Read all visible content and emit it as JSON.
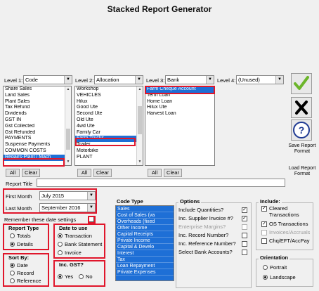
{
  "title": "Stacked Report Generator",
  "levels": [
    {
      "label": "Level 1:",
      "value": "Code"
    },
    {
      "label": "Level 2:",
      "value": "Allocation"
    },
    {
      "label": "Level 3:",
      "value": "Bank"
    },
    {
      "label": "Level 4:",
      "value": "(Unused)"
    }
  ],
  "list1": [
    "Share Sales",
    "Land Sales",
    "Plant Sales",
    "Tax Refund",
    "Dividends",
    "GST IN",
    "Gst Collected",
    "Gst Refunded",
    "PAYMENTS",
    "Suspense Payments",
    "COMMON COSTS",
    "Repairs-Plant / Mach"
  ],
  "list1_selected": "Repairs-Plant / Mach",
  "list2": [
    "Workshop",
    "VEHICLES",
    "Hilux",
    "Good Ute",
    "Second Ute",
    "Old Ute",
    "4wd Ute",
    "Family Car",
    "Farm Trucks",
    "Trailer",
    "Motorbike",
    "PLANT"
  ],
  "list2_selected": "Farm Trucks",
  "list3": [
    "Farm Cheque Account",
    "Term Loan",
    "Home Loan",
    "Hilux Ute",
    "Harvest Loan"
  ],
  "list3_selected": "Farm Cheque Account",
  "buttons": {
    "all": "All",
    "clear": "Clear"
  },
  "report_title_label": "Report Title",
  "report_title_value": "",
  "first_month_label": "First Month",
  "first_month_value": "July 2015",
  "last_month_label": "Last Month",
  "last_month_value": "September 2016",
  "remember_label": "Remember these date settings",
  "report_type": {
    "legend": "Report Type",
    "options": [
      "Totals",
      "Details"
    ],
    "selected": "Details"
  },
  "date_to_use": {
    "legend": "Date to use",
    "options": [
      "Transaction",
      "Bank Statement",
      "Invoice"
    ],
    "selected": "Transaction"
  },
  "sort_by": {
    "legend": "Sort By:",
    "options": [
      "Date",
      "Record",
      "Reference"
    ],
    "selected": "Date"
  },
  "inc_gst": {
    "legend": "Inc. GST?",
    "options": [
      "Yes",
      "No"
    ],
    "selected": "Yes"
  },
  "code_type": {
    "legend": "Code Type",
    "items": [
      "Sales",
      "Cost of Sales (va",
      "Overheads (fixed",
      "Other Income",
      "Capital Receipts",
      "Private Income",
      "Capital & Develo",
      "Interest",
      "Tax",
      "Loan Repayment",
      "Private Expenses"
    ]
  },
  "options": {
    "legend": "Options",
    "items": [
      {
        "label": "Include Quantities?",
        "checked": true,
        "enabled": true
      },
      {
        "label": "Inc. Supplier Invoice #?",
        "checked": true,
        "enabled": true
      },
      {
        "label": "Enterprise Margins?",
        "checked": false,
        "enabled": false
      },
      {
        "label": "Inc. Record Number?",
        "checked": false,
        "enabled": true
      },
      {
        "label": "Inc. Reference Number?",
        "checked": false,
        "enabled": true
      },
      {
        "label": "Select Bank Accounts?",
        "checked": false,
        "enabled": true
      }
    ]
  },
  "include": {
    "legend": "Include:",
    "items": [
      {
        "label": "Cleared Transactions",
        "checked": true,
        "enabled": true
      },
      {
        "label": "OS Transactions",
        "checked": true,
        "enabled": true
      },
      {
        "label": "Invoices/Accruals",
        "checked": false,
        "enabled": false
      },
      {
        "label": "Chq/EFT/AccPay",
        "checked": false,
        "enabled": true
      }
    ]
  },
  "orientation": {
    "legend": "Orientation",
    "options": [
      "Portrait",
      "Landscape"
    ],
    "selected": "Landscape"
  },
  "side": {
    "save_label": "Save Report Format",
    "load_label": "Load Report Format"
  },
  "colors": {
    "accent": "#1e6fd6",
    "highlight_border": "#e0162b",
    "ok_check": "#6bb52a"
  }
}
